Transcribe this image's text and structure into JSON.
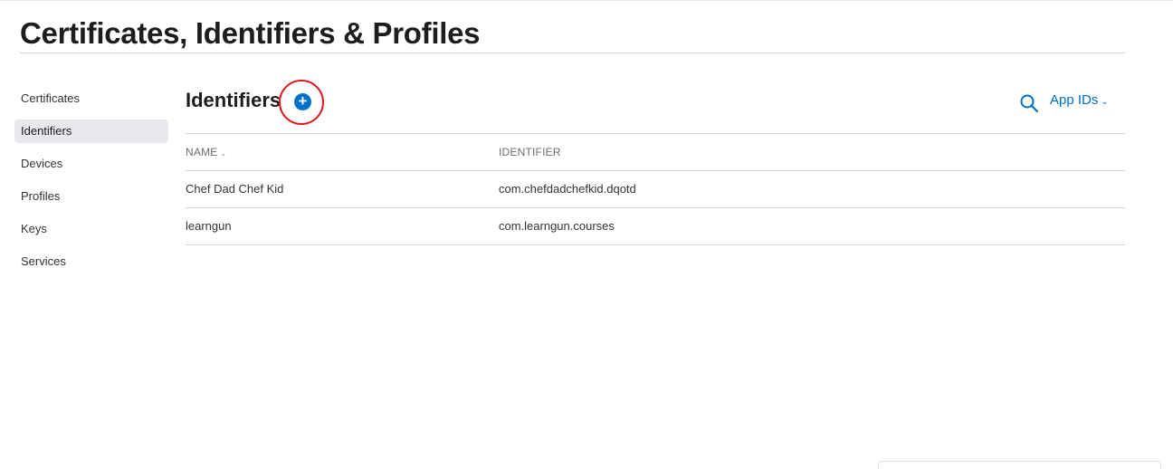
{
  "page": {
    "title": "Certificates, Identifiers & Profiles"
  },
  "sidebar": {
    "items": [
      {
        "label": "Certificates",
        "active": false
      },
      {
        "label": "Identifiers",
        "active": true
      },
      {
        "label": "Devices",
        "active": false
      },
      {
        "label": "Profiles",
        "active": false
      },
      {
        "label": "Keys",
        "active": false
      },
      {
        "label": "Services",
        "active": false
      }
    ]
  },
  "section": {
    "title": "Identifiers",
    "add_icon": "plus-circle-icon",
    "search_icon": "search-icon",
    "filter_label": "App IDs",
    "filter_icon": "chevron-down-icon"
  },
  "table": {
    "columns": [
      "NAME",
      "IDENTIFIER"
    ],
    "sort_icon": "chevron-down-icon",
    "rows": [
      {
        "name": "Chef Dad Chef Kid",
        "identifier": "com.chefdadchefkid.dqotd"
      },
      {
        "name": "learngun",
        "identifier": "com.learngun.courses"
      }
    ]
  },
  "colors": {
    "accent": "#0070c9",
    "highlight": "#e0161b",
    "active_item_bg": "#e8e8ed",
    "divider": "#d2d2d7"
  }
}
